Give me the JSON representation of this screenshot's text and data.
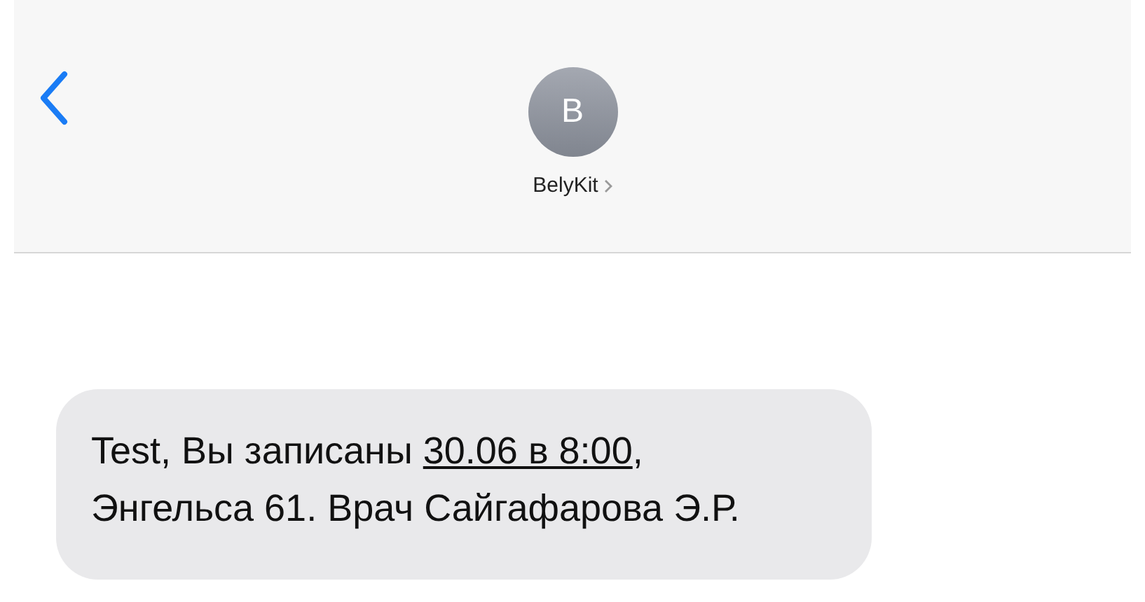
{
  "header": {
    "avatar_letter": "B",
    "contact_name": "BelyKit"
  },
  "message": {
    "before": "Test, Вы записаны ",
    "link": "30.06 в 8:00",
    "after": ", Энгельса 61. Врач Сайгафарова Э.Р."
  }
}
